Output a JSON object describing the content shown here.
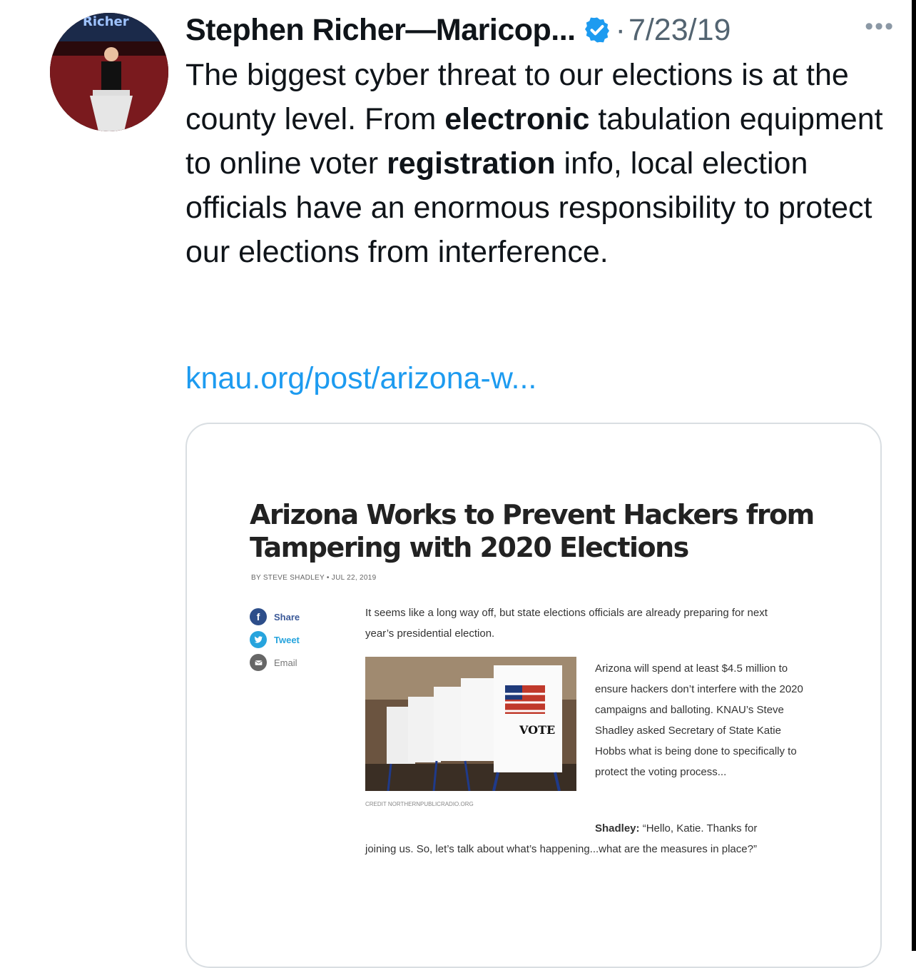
{
  "tweet": {
    "author_name": "Stephen Richer—Maricop...",
    "date": "7/23/19",
    "separator": "·",
    "more_icon": "more-icon",
    "avatar_label": "Richer",
    "text": {
      "p1": "The biggest cyber threat to our elections is at the county level.  From ",
      "b1": "electronic",
      "p2": " tabulation equipment to online voter ",
      "b2": "registration",
      "p3": " info, local election officials have an enormous responsibility to protect our elections from interference."
    },
    "link_text": "knau.org/post/arizona-w..."
  },
  "card": {
    "title": "Arizona Works to Prevent Hackers from Tampering with 2020 Elections",
    "byline": "By STEVE SHADLEY • JUL 22, 2019",
    "share": {
      "share_label": "Share",
      "tweet_label": "Tweet",
      "email_label": "Email"
    },
    "intro": "It seems like a long way off, but state elections officials are already preparing for next year’s presidential election.",
    "photo_text": "VOTE",
    "photo_credit": "CREDIT NORTHERNPUBLICRADIO.ORG",
    "body": "Arizona will spend at least $4.5 million to ensure hackers don’t interfere with the 2020 campaigns and balloting. KNAU’s Steve Shadley asked Secretary of State Katie Hobbs what is being done to specifically to protect the voting process...",
    "quote_speaker": "Shadley:",
    "quote_start": " “Hello, Katie. Thanks for",
    "quote_rest": "joining us. So, let’s talk about what’s happening...what are the measures in place?”"
  },
  "colors": {
    "link": "#1d9bf0",
    "verified": "#1d9bf0",
    "muted": "#536471"
  }
}
